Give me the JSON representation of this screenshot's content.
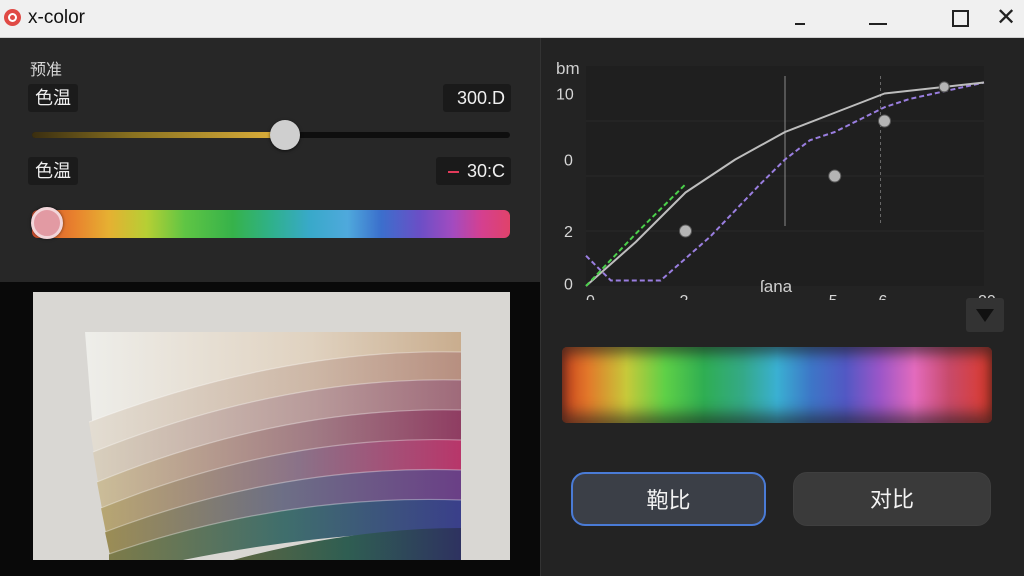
{
  "window": {
    "title": "x-color",
    "controls": {
      "minimize_label": "",
      "maximize_label": "",
      "close_label": "✕"
    }
  },
  "adjust": {
    "section_label": "预准",
    "temp1": {
      "label": "色温",
      "value": "300.D",
      "level": 0.53
    },
    "temp2": {
      "label": "色温",
      "value": "30:C",
      "hue_level": 0.02
    }
  },
  "curve_chart": {
    "chart_data": {
      "type": "line",
      "ylabel": "bm",
      "xlabel": "ſana",
      "x_ticks": [
        "0",
        "2",
        "5",
        "6",
        "20"
      ],
      "y_ticks": [
        "10",
        "0",
        "2",
        "0"
      ],
      "series": [
        {
          "style": "dashed-purple",
          "color": "#9a7ee0",
          "points": [
            [
              0,
              0.55
            ],
            [
              0.5,
              0.1
            ],
            [
              1.5,
              0.1
            ],
            [
              2.5,
              0.9
            ],
            [
              3.5,
              1.85
            ],
            [
              4,
              2.3
            ],
            [
              4.5,
              2.65
            ],
            [
              5,
              2.8
            ],
            [
              6,
              3.25
            ],
            [
              6.5,
              3.4
            ],
            [
              8,
              3.7
            ]
          ]
        },
        {
          "style": "solid-gray",
          "color": "#bdbdbd",
          "points": [
            [
              0,
              0
            ],
            [
              1,
              0.8
            ],
            [
              2,
              1.7
            ],
            [
              3,
              2.3
            ],
            [
              4,
              2.8
            ],
            [
              5,
              3.15
            ],
            [
              6,
              3.5
            ],
            [
              8,
              3.7
            ]
          ]
        },
        {
          "style": "dashed-green",
          "color": "#4bd04b",
          "points": [
            [
              0,
              0
            ],
            [
              1,
              0.95
            ],
            [
              2,
              1.85
            ]
          ]
        }
      ],
      "control_points": [
        [
          2,
          1.0
        ],
        [
          5,
          2.0
        ],
        [
          6,
          3.0
        ],
        [
          7.2,
          3.62
        ]
      ],
      "colors": {
        "purple": "#9a7ee0",
        "gray": "#bdbdbd",
        "green": "#4bd04b"
      }
    }
  },
  "dropdown": {
    "icon": "triangle-down-icon"
  },
  "buttons": {
    "preview_label": "鞄比",
    "compare_label": "对比"
  },
  "colors": {
    "accent": "#4a7bd6",
    "panel": "#272727",
    "background": "#1a1a1a"
  }
}
